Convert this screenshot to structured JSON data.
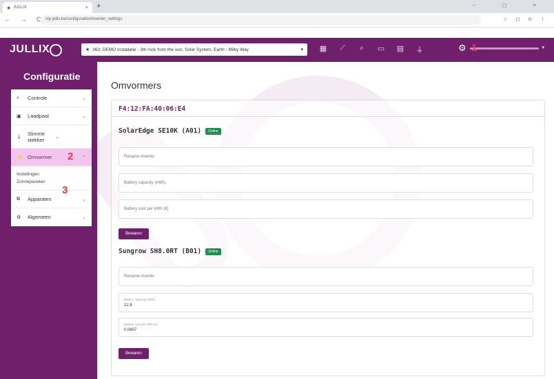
{
  "browser": {
    "tab_title": "JULLIX",
    "tab_close": "×",
    "new_tab": "+",
    "window_controls": "– ◻ ×",
    "nav_icons": "← → C",
    "url": "nlp.jullix.be/configuration/inverter_settings",
    "right_icons": "☆ ◻ ⊙ ⋮"
  },
  "header": {
    "logo": "JULLIX",
    "site_star": "★",
    "site_selector": "363: DEMO Installatie - 3th rock from the sun, Solar System, Earth - Milky Way",
    "site_caret": "▾",
    "icons": [
      "grid-icon",
      "chart-icon",
      "search-icon",
      "battery-icon",
      "device-icon",
      "plug-icon"
    ],
    "user_caret": "▾"
  },
  "annotations": {
    "one": "1",
    "two": "2",
    "three": "3"
  },
  "sidebar": {
    "title": "Configuratie",
    "items": [
      {
        "label": "Controle",
        "icon": "check-icon",
        "chevron": "⌄"
      },
      {
        "label": "Laadpaal",
        "icon": "charger-icon",
        "chevron": "⌄"
      },
      {
        "label": "Slimme stekker",
        "icon": "plug-icon",
        "chevron": "⌄"
      },
      {
        "label": "Omvormer",
        "icon": "inverter-icon",
        "chevron": "⌃"
      },
      {
        "label": "Apparaten",
        "icon": "devices-icon",
        "chevron": "⌄"
      },
      {
        "label": "Algemeen",
        "icon": "cog-icon",
        "chevron": "⌄"
      }
    ],
    "subitems": [
      "Instellingen",
      "Zonnepanelen"
    ]
  },
  "main": {
    "title": "Omvormers",
    "device_id": "F4:12:FA:40:06:E4",
    "inverters": [
      {
        "name": "SolarEdge SE10K (A01)",
        "status": "Online",
        "rename_placeholder": "Rename inverter",
        "capacity_placeholder": "Battery capacity (kWh)",
        "cost_placeholder": "Battery cost per kWh (€)",
        "save_label": "Bewaren"
      },
      {
        "name": "Sungrow SH8.0RT (B01)",
        "status": "Online",
        "rename_placeholder": "Rename inverter",
        "capacity_label": "Battery capacity (kWh)",
        "capacity_value": "12.8",
        "cost_label": "Battery cost per kWh (€)",
        "cost_value": "0.0607",
        "save_label": "Bewaren"
      }
    ]
  },
  "colors": {
    "brand": "#6f1f6b",
    "active": "#f2c5ee",
    "online": "#1e8f4e",
    "annotation": "#e53b3b"
  }
}
